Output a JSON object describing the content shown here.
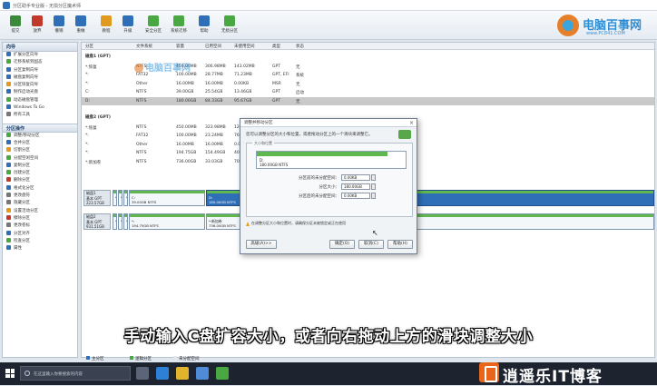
{
  "app": {
    "title": "分区助手专业版 - 无损分区魔术师"
  },
  "toolbar": {
    "buttons": [
      {
        "label": "提交",
        "color": "#3a8a3a"
      },
      {
        "label": "放弃",
        "color": "#c0392b"
      },
      {
        "label": "撤销",
        "color": "#2f6fb8"
      },
      {
        "label": "重做",
        "color": "#2f6fb8"
      },
      {
        "label": "教程",
        "color": "#e09a1f"
      },
      {
        "label": "升级",
        "color": "#2f6fb8"
      },
      {
        "label": "安全分区",
        "color": "#4aa843"
      },
      {
        "label": "系统迁移",
        "color": "#4aa843"
      },
      {
        "label": "帮助",
        "color": "#2f6fb8"
      },
      {
        "label": "无损分区",
        "color": "#4aa843"
      }
    ]
  },
  "brand_top": {
    "name": "电脑百事网",
    "url": "www.PC841.COM"
  },
  "watermark": {
    "text": "电脑百事网"
  },
  "sidebar": {
    "wizard_title": "向导",
    "wizard_items": [
      {
        "label": "扩展分区向导",
        "color": "#2f6fb8"
      },
      {
        "label": "迁移系统到固态",
        "color": "#4aa843"
      },
      {
        "label": "分区复制向导",
        "color": "#2f6fb8"
      },
      {
        "label": "磁盘复制向导",
        "color": "#2f6fb8"
      },
      {
        "label": "分区恢复向导",
        "color": "#e09a1f"
      },
      {
        "label": "制作启动光盘",
        "color": "#2f6fb8"
      },
      {
        "label": "动态磁盘管理",
        "color": "#4aa843"
      },
      {
        "label": "Windows To Go",
        "color": "#2f6fb8"
      },
      {
        "label": "所有工具",
        "color": "#777777"
      }
    ],
    "ops_title": "分区操作",
    "ops_items": [
      {
        "label": "调整/移动分区",
        "color": "#4aa843"
      },
      {
        "label": "合并分区",
        "color": "#2f6fb8"
      },
      {
        "label": "切割分区",
        "color": "#e09a1f"
      },
      {
        "label": "分配空闲空间",
        "color": "#4aa843"
      },
      {
        "label": "复制分区",
        "color": "#2f6fb8"
      },
      {
        "label": "创建分区",
        "color": "#4aa843"
      },
      {
        "label": "删除分区",
        "color": "#c0392b"
      },
      {
        "label": "格式化分区",
        "color": "#2f6fb8"
      },
      {
        "label": "更改盘符",
        "color": "#777777"
      },
      {
        "label": "隐藏分区",
        "color": "#777777"
      },
      {
        "label": "设置活动分区",
        "color": "#e09a1f"
      },
      {
        "label": "擦除分区",
        "color": "#c0392b"
      },
      {
        "label": "更改卷标",
        "color": "#777777"
      },
      {
        "label": "分区对齐",
        "color": "#2f6fb8"
      },
      {
        "label": "检查分区",
        "color": "#4aa843"
      },
      {
        "label": "属性",
        "color": "#2f6fb8"
      }
    ]
  },
  "table": {
    "headers": [
      "分区",
      "文件系统",
      "容量",
      "已用空间",
      "未使用空间",
      "类型",
      "状态"
    ],
    "disks": [
      {
        "title": "磁盘1 (GPT)",
        "rows": [
          {
            "cells": [
              "*:恢复",
              "NTFS",
              "450.00MB",
              "306.98MB",
              "143.02MB",
              "GPT",
              "无"
            ],
            "selected": false
          },
          {
            "cells": [
              "*:",
              "FAT32",
              "100.00MB",
              "28.77MB",
              "71.23MB",
              "GPT, EFI",
              "系统"
            ],
            "selected": false
          },
          {
            "cells": [
              "*:",
              "Other",
              "16.00MB",
              "16.00MB",
              "0.00KB",
              "MSR",
              "无"
            ],
            "selected": false
          },
          {
            "cells": [
              "C:",
              "NTFS",
              "39.00GB",
              "25.54GB",
              "13.46GB",
              "GPT",
              "启动"
            ],
            "selected": false
          },
          {
            "cells": [
              "D:",
              "NTFS",
              "180.00GB",
              "84.33GB",
              "95.67GB",
              "GPT",
              "无"
            ],
            "selected": true
          }
        ]
      },
      {
        "title": "磁盘2 (GPT)",
        "rows": [
          {
            "cells": [
              "*:恢复",
              "NTFS",
              "450.00MB",
              "323.98MB",
              "126.02MB",
              "GPT",
              "无"
            ],
            "selected": false
          },
          {
            "cells": [
              "*:",
              "FAT32",
              "100.00MB",
              "23.24MB",
              "76.76MB",
              "GPT, EFI",
              "无"
            ],
            "selected": false
          },
          {
            "cells": [
              "*:",
              "Other",
              "16.00MB",
              "16.00MB",
              "0.00KB",
              "MSR",
              "无"
            ],
            "selected": false
          },
          {
            "cells": [
              "*:",
              "NTFS",
              "194.75GB",
              "154.49GB",
              "40.26GB",
              "GPT",
              "无"
            ],
            "selected": false
          },
          {
            "cells": [
              "*:新加卷",
              "NTFS",
              "736.00GB",
              "33.03GB",
              "702.97GB",
              "GPT",
              "无"
            ],
            "selected": false
          }
        ]
      }
    ]
  },
  "diskmap": [
    {
      "label": "磁盘1",
      "type": "基本 GPT",
      "size": "223.57GB",
      "segments": [
        {
          "name": "*",
          "detail": "",
          "selected": false
        },
        {
          "name": "*",
          "detail": "",
          "selected": false
        },
        {
          "name": "*",
          "detail": "",
          "selected": false
        },
        {
          "name": "C:",
          "detail": "39.00GB NTFS",
          "selected": false
        },
        {
          "name": "D:",
          "detail": "180.00GB NTFS",
          "selected": true
        }
      ]
    },
    {
      "label": "磁盘2",
      "type": "基本 GPT",
      "size": "931.51GB",
      "segments": [
        {
          "name": "*",
          "detail": "",
          "selected": false
        },
        {
          "name": "*",
          "detail": "",
          "selected": false
        },
        {
          "name": "*",
          "detail": "",
          "selected": false
        },
        {
          "name": "*:",
          "detail": "194.75GB NTFS",
          "selected": false
        },
        {
          "name": "*:新加卷",
          "detail": "736.00GB NTFS",
          "selected": false
        }
      ]
    }
  ],
  "legend": [
    {
      "label": "主分区",
      "color": "#2f6fb8"
    },
    {
      "label": "逻辑分区",
      "color": "#4aa843"
    },
    {
      "label": "未分配空间",
      "color": "#e6e6e6"
    }
  ],
  "dialog": {
    "title": "调整并移动分区",
    "description": "您可以调整分区的大小和位置，或者拖动分区上的一个滑块来调整它。",
    "group_label": "大小和位置",
    "slider_fill": 0.88,
    "slider_name": "D:",
    "slider_detail": "180.00GB NTFS",
    "fields": [
      {
        "label": "分区前的未分配空间：",
        "value": "0.00KB"
      },
      {
        "label": "分区大小：",
        "value": "180.00GB"
      },
      {
        "label": "分区后的未分配空间：",
        "value": "0.00KB"
      }
    ],
    "warning": "在调整分区大小和位置时，请确保分区未被锁定或正在使用",
    "btn_advanced": "高级(A)>>",
    "btn_ok": "确定(O)",
    "btn_cancel": "取消(C)",
    "btn_help": "帮助(H)"
  },
  "subtitle": "手动输入C盘扩容大小，或者向右拖动上方的滑块调整大小",
  "taskbar": {
    "search_placeholder": "在这里输入你要搜索的内容",
    "apps": [
      {
        "name": "task-view",
        "color": "#5b6577"
      },
      {
        "name": "edge",
        "color": "#2e7fd6"
      },
      {
        "name": "explorer",
        "color": "#e2b32d"
      },
      {
        "name": "store",
        "color": "#4f8bd6"
      },
      {
        "name": "partition-assistant",
        "color": "#4aa843"
      }
    ]
  },
  "brand_bottom": {
    "name": "逍遥乐IT博客"
  }
}
